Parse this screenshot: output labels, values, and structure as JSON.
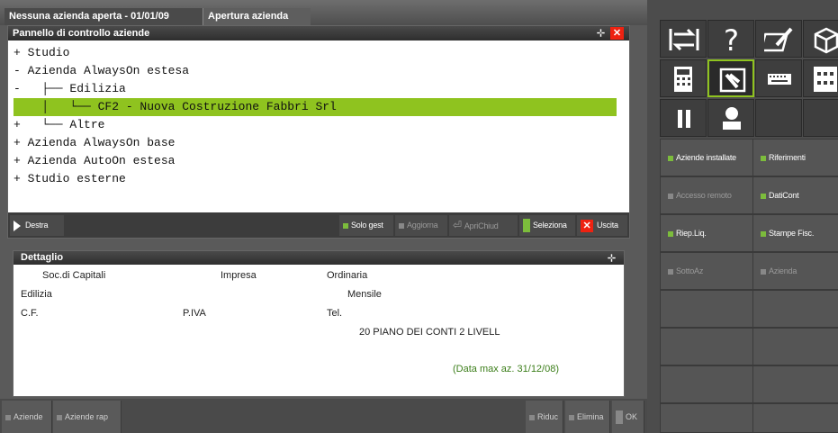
{
  "title_tabs": [
    "Nessuna azienda aperta - 01/01/09",
    "Apertura azienda"
  ],
  "panel": {
    "title": "Pannello di controllo aziende",
    "tree": [
      "+ Studio",
      "- Azienda AlwaysOn estesa",
      "-   ├── Edilizia",
      "    │   └── CF2 - Nuova Costruzione Fabbri Srl",
      "+   └── Altre",
      "+ Azienda AlwaysOn base",
      "+ Azienda AutoOn estesa",
      "+ Studio esterne"
    ],
    "toolbar": {
      "destra": "Destra",
      "solo_gest": "Solo gest",
      "aggiorna": "Aggiorna",
      "apri_chiud": "ApriChiud",
      "seleziona": "Seleziona",
      "uscita": "Uscita"
    }
  },
  "detail": {
    "title": "Dettaglio",
    "soc": "Soc.di Capitali",
    "impresa": "Impresa",
    "ordinaria": "Ordinaria",
    "attivita": "Edilizia",
    "periodicita": "Mensile",
    "cf": "C.F.",
    "piva": "P.IVA",
    "tel": "Tel.",
    "piano": "20  PIANO DEI CONTI 2 LIVELL",
    "data_max": "(Data max az. 31/12/08)"
  },
  "bottom": {
    "aziende": "Aziende",
    "aziende_rap": "Aziende rap",
    "riduc": "Riduc",
    "elimina": "Elimina",
    "ok": "OK"
  },
  "right_panel": {
    "icons": [
      "arrows-icon",
      "help-icon",
      "edit-icon",
      "cube-icon",
      "calculator-icon",
      "hand-icon",
      "keyboard-icon",
      "grid-icon",
      "pause-icon",
      "user-icon"
    ],
    "buttons": {
      "aziende_installate": "Aziende installate",
      "riferimenti": "Riferimenti",
      "accesso_remoto": "Accesso remoto",
      "daticont": "DatiCont",
      "riep_liq": "Riep.Liq.",
      "stampe_fisc": "Stampe Fisc.",
      "sottoaz": "SottoAz",
      "azienda": "Azienda"
    }
  },
  "colors": {
    "accent": "#8fc31f",
    "close": "#e21111"
  }
}
